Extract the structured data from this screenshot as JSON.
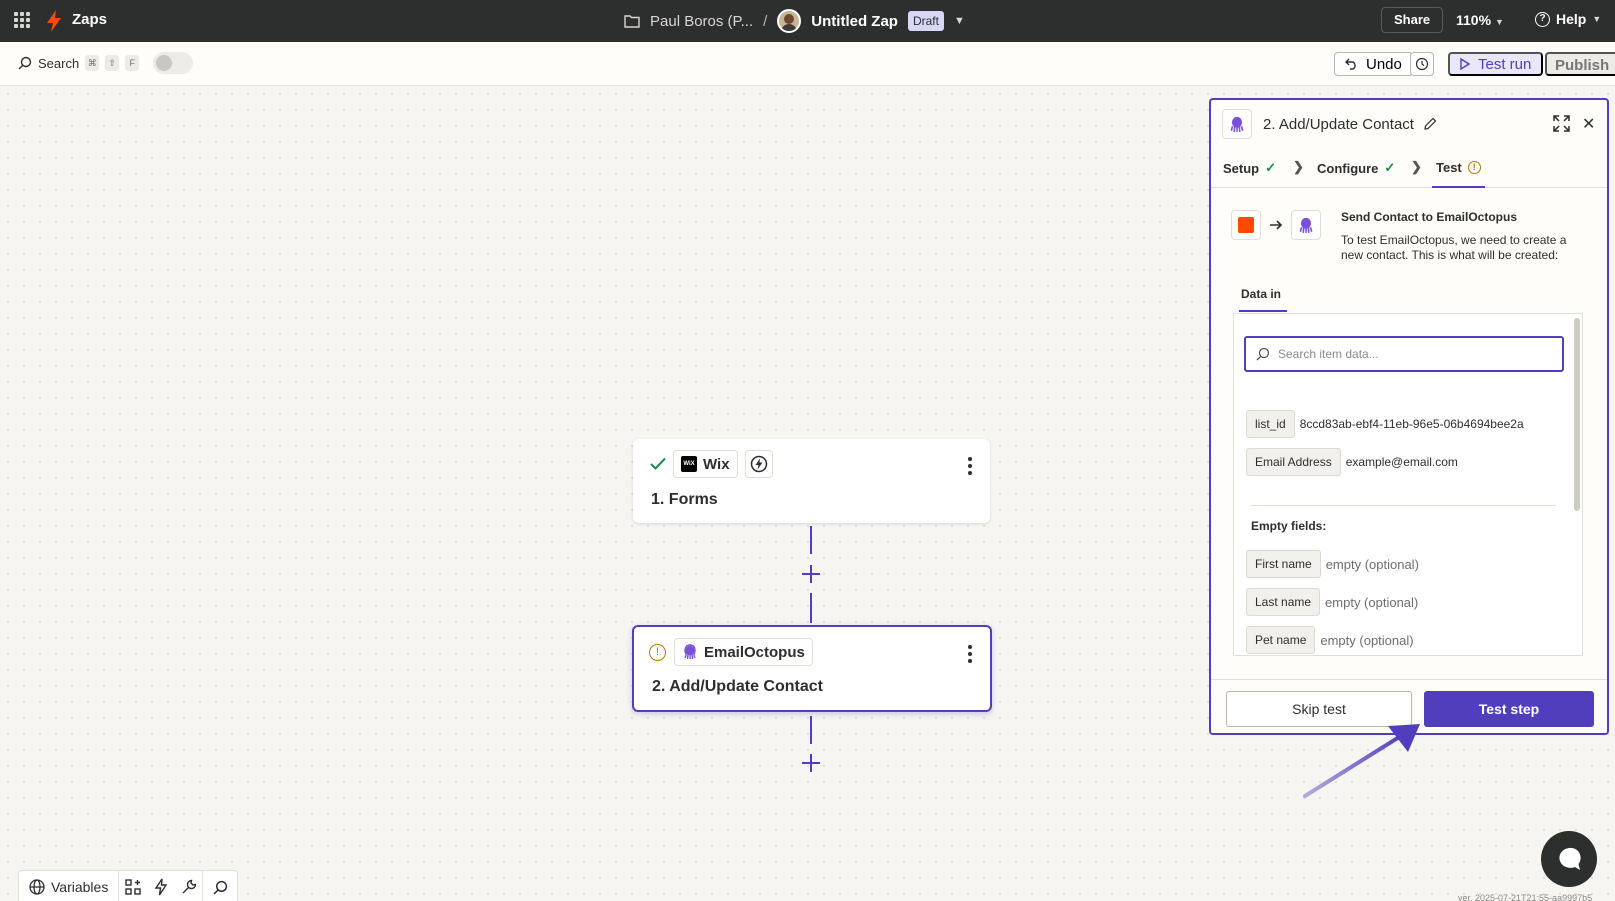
{
  "topbar": {
    "app_label": "Zaps",
    "folder_label": "Paul Boros (P...",
    "separator": "/",
    "zap_name": "Untitled Zap",
    "status_badge": "Draft",
    "share_label": "Share",
    "zoom_label": "110%",
    "help_label": "Help"
  },
  "toolbar": {
    "search_label": "Search",
    "shortcut_keys": [
      "⌘",
      "⇧",
      "F"
    ],
    "undo_label": "Undo",
    "test_run_label": "Test run",
    "publish_label": "Publish"
  },
  "canvas": {
    "step1": {
      "app_name": "Wix",
      "app_logo_text": "WiX",
      "number": "1.",
      "title": "Forms"
    },
    "step2": {
      "app_name": "EmailOctopus",
      "number": "2.",
      "title": "Add/Update Contact"
    }
  },
  "panel": {
    "title_number": "2.",
    "title": "Add/Update Contact",
    "tabs": [
      {
        "label": "Setup",
        "status": "complete"
      },
      {
        "label": "Configure",
        "status": "complete"
      },
      {
        "label": "Test",
        "status": "warning"
      }
    ],
    "send_title": "Send Contact to EmailOctopus",
    "send_desc": "To test EmailOctopus, we need to create a new contact. This is what will be created:",
    "data_in_tab": "Data in",
    "search_placeholder": "Search item data...",
    "fields": [
      {
        "key": "list_id",
        "value": "8ccd83ab-ebf4-11eb-96e5-06b4694bee2a"
      },
      {
        "key": "Email Address",
        "value": "example@email.com"
      }
    ],
    "empty_fields_title": "Empty fields:",
    "empty_fields": [
      {
        "key": "First name",
        "value": "empty (optional)"
      },
      {
        "key": "Last name",
        "value": "empty (optional)"
      },
      {
        "key": "Pet name",
        "value": "empty (optional)"
      }
    ],
    "skip_label": "Skip test",
    "test_step_label": "Test step"
  },
  "bottom": {
    "variables_label": "Variables",
    "version_text": "ver. 2025-07-21T21:55-aa9997b5"
  },
  "colors": {
    "accent": "#503ebd",
    "topbar_bg": "#2d2e2e",
    "zapier_orange": "#ff4a00",
    "success": "#1e8a4c",
    "warning": "#b07c00"
  }
}
